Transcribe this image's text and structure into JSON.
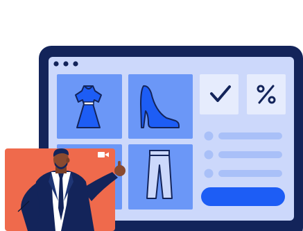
{
  "colors": {
    "frame": "#13245a",
    "screen": "#ccd8fb",
    "card_blue": "#6b97f7",
    "card_light": "#e6ecfd",
    "accent_blue": "#1d5df5",
    "line_blue": "#a9c0f8",
    "video_bg": "#ef6a4c",
    "skin": "#8a4a2f"
  },
  "icons": {
    "window_dots": "three-dots-icon",
    "tile_1": "dress-icon",
    "tile_2": "high-heel-shoe-icon",
    "tile_3": "pants-icon",
    "check": "checkmark-icon",
    "percent": "percent-icon",
    "camera": "video-camera-icon"
  }
}
